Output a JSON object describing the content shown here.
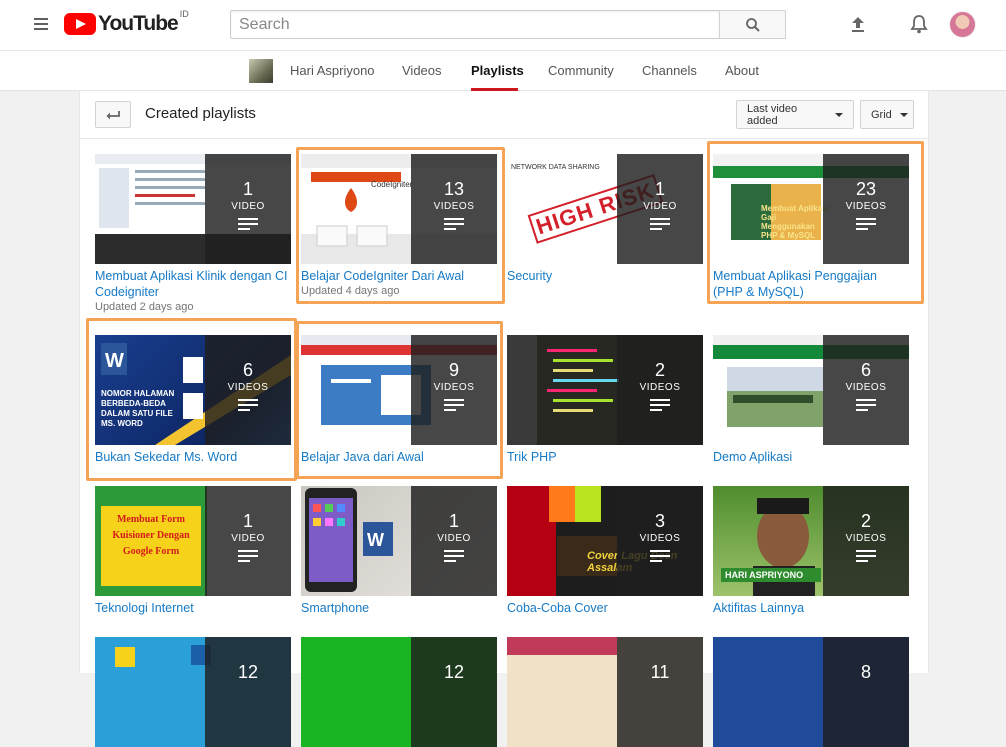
{
  "header": {
    "logo_text": "YouTube",
    "country": "ID",
    "search_placeholder": "Search"
  },
  "channel": {
    "name": "Hari Aspriyono",
    "tabs": [
      "Videos",
      "Playlists",
      "Community",
      "Channels",
      "About"
    ],
    "active_tab": "Playlists"
  },
  "section": {
    "title": "Created playlists",
    "sort_label": "Last video added",
    "view_label": "Grid"
  },
  "playlists": [
    {
      "title": "Membuat Aplikasi Klinik dengan CI Codeigniter",
      "count": "1",
      "unit": "VIDEO",
      "updated": "Updated 2 days ago"
    },
    {
      "title": "Belajar CodeIgniter Dari Awal",
      "count": "13",
      "unit": "VIDEOS",
      "updated": "Updated 4 days ago"
    },
    {
      "title": "Security",
      "count": "1",
      "unit": "VIDEO",
      "updated": ""
    },
    {
      "title": "Membuat Aplikasi Penggajian (PHP & MySQL)",
      "count": "23",
      "unit": "VIDEOS",
      "updated": ""
    },
    {
      "title": "Bukan Sekedar Ms. Word",
      "count": "6",
      "unit": "VIDEOS",
      "updated": ""
    },
    {
      "title": "Belajar Java dari Awal",
      "count": "9",
      "unit": "VIDEOS",
      "updated": ""
    },
    {
      "title": "Trik PHP",
      "count": "2",
      "unit": "VIDEOS",
      "updated": ""
    },
    {
      "title": "Demo Aplikasi",
      "count": "6",
      "unit": "VIDEOS",
      "updated": ""
    },
    {
      "title": "Teknologi Internet",
      "count": "1",
      "unit": "VIDEO",
      "updated": ""
    },
    {
      "title": "Smartphone",
      "count": "1",
      "unit": "VIDEO",
      "updated": ""
    },
    {
      "title": "Coba-Coba Cover",
      "count": "3",
      "unit": "VIDEOS",
      "updated": ""
    },
    {
      "title": "Aktifitas Lainnya",
      "count": "2",
      "unit": "VIDEOS",
      "updated": ""
    },
    {
      "title": "",
      "count": "12",
      "unit": "",
      "updated": ""
    },
    {
      "title": "",
      "count": "12",
      "unit": "",
      "updated": ""
    },
    {
      "title": "",
      "count": "11",
      "unit": "",
      "updated": ""
    },
    {
      "title": "",
      "count": "8",
      "unit": "",
      "updated": ""
    }
  ],
  "thumb_text": {
    "t2_brand": "CodeIgniter",
    "t3_heading": "NETWORK DATA SHARING",
    "t3_stamp": "HIGH RISK",
    "t4_caption": "Membuat Aplikasi Gaji Menggunakan PHP & MySQL",
    "t5_caption": "NOMOR HALAMAN BERBEDA-BEDA DALAM SATU FILE MS. WORD",
    "t9_caption": "Membuat Form Kuisioner Dengan Google Form",
    "t11_caption": "Cover Lagu Deen Assalam",
    "t12_caption": "HARI ASPRIYONO"
  },
  "colors": {
    "highlight": "#f5a455",
    "link": "#167ac6",
    "brand_red": "#ff0000"
  }
}
